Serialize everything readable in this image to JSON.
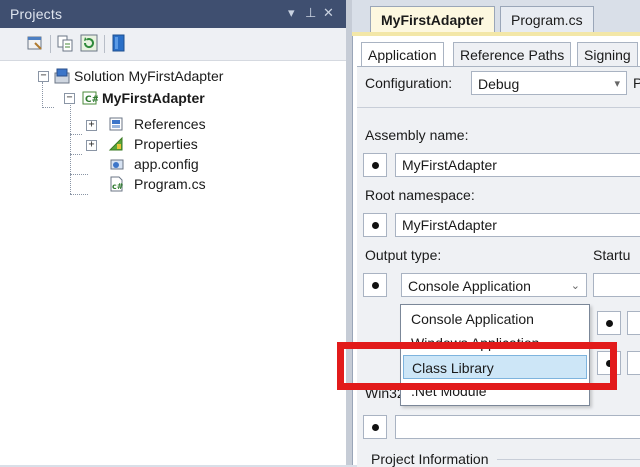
{
  "projects_pane": {
    "title": "Projects",
    "controls": [
      "▾",
      "⊥",
      "✕"
    ],
    "toolbar_icons": [
      "properties-icon",
      "show-all-files-icon",
      "refresh-icon",
      "view-class-diagram-icon"
    ],
    "tree": {
      "solution_label": "Solution MyFirstAdapter",
      "project_label": "MyFirstAdapter",
      "items": [
        {
          "label": "References",
          "icon": "references-icon"
        },
        {
          "label": "Properties",
          "icon": "properties-folder-icon"
        },
        {
          "label": "app.config",
          "icon": "config-file-icon"
        },
        {
          "label": "Program.cs",
          "icon": "csharp-file-icon"
        }
      ]
    }
  },
  "document_tabs": {
    "active": "MyFirstAdapter",
    "inactive": "Program.cs"
  },
  "property_tabs": {
    "items": [
      "Application",
      "Reference Paths",
      "Signing"
    ]
  },
  "config": {
    "label": "Configuration:",
    "value": "Debug",
    "trailing": "P"
  },
  "assembly": {
    "label": "Assembly name:",
    "value": "MyFirstAdapter"
  },
  "root_ns": {
    "label": "Root namespace:",
    "value": "MyFirstAdapter"
  },
  "output": {
    "label": "Output type:",
    "startup_label": "Startu",
    "value": "Console Application",
    "options": [
      "Console Application",
      "Windows Application",
      "Class Library",
      ".Net Module"
    ],
    "selected_option": "Class Library"
  },
  "win32": {
    "label": "Win32"
  },
  "project_info": {
    "label": "Project Information"
  },
  "colors": {
    "pane_header": "#3f4f70",
    "highlight": "#e21b1b",
    "selection": "#cde6f7"
  }
}
